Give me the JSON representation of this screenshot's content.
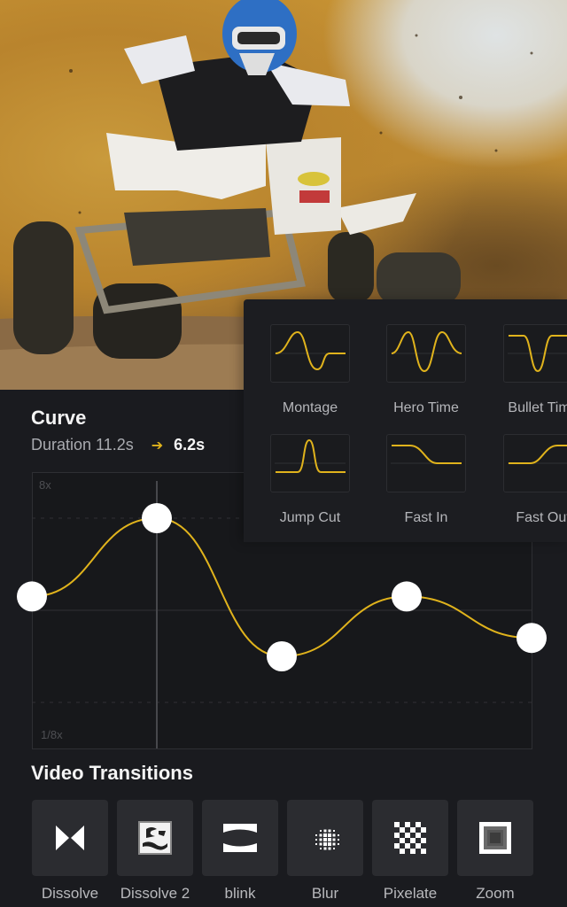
{
  "photo": {
    "subject": "atv-rider-in-dust"
  },
  "curve": {
    "title": "Curve",
    "duration_label": "Duration 11.2s",
    "arrow": "➔",
    "new_duration": "6.2s"
  },
  "presets": [
    {
      "label": "Montage",
      "icon": "montage-curve-icon"
    },
    {
      "label": "Hero Time",
      "icon": "hero-time-curve-icon"
    },
    {
      "label": "Bullet Time",
      "icon": "bullet-time-curve-icon"
    },
    {
      "label": "Jump Cut",
      "icon": "jump-cut-curve-icon"
    },
    {
      "label": "Fast In",
      "icon": "fast-in-curve-icon"
    },
    {
      "label": "Fast Out",
      "icon": "fast-out-curve-icon"
    }
  ],
  "transitions": {
    "title": "Video Transitions",
    "items": [
      {
        "label": "Dissolve",
        "icon": "dissolve-icon"
      },
      {
        "label": "Dissolve 2",
        "icon": "dissolve-2-icon"
      },
      {
        "label": "blink",
        "icon": "blink-icon"
      },
      {
        "label": "Blur",
        "icon": "blur-icon"
      },
      {
        "label": "Pixelate",
        "icon": "pixelate-icon"
      },
      {
        "label": "Zoom",
        "icon": "zoom-icon"
      }
    ]
  },
  "colors": {
    "accent": "#e0b31c",
    "background": "#1a1b1f",
    "tile": "#2b2c30"
  },
  "chart_data": {
    "type": "line",
    "title": "Curve",
    "ylabel_top": "8x",
    "ylabel_bottom": "1/8x",
    "y_scale": "log2",
    "ylim": [
      -3,
      3
    ],
    "xlim": [
      0,
      1
    ],
    "x": [
      0,
      0.25,
      0.5,
      0.75,
      1.0
    ],
    "y": [
      0.3,
      2.0,
      -1.0,
      0.3,
      -0.6
    ],
    "control_points": 5,
    "playhead_x": 0.25,
    "gridlines": [
      2,
      0,
      -2
    ],
    "grid": true,
    "line_color": "#e0b31c"
  }
}
